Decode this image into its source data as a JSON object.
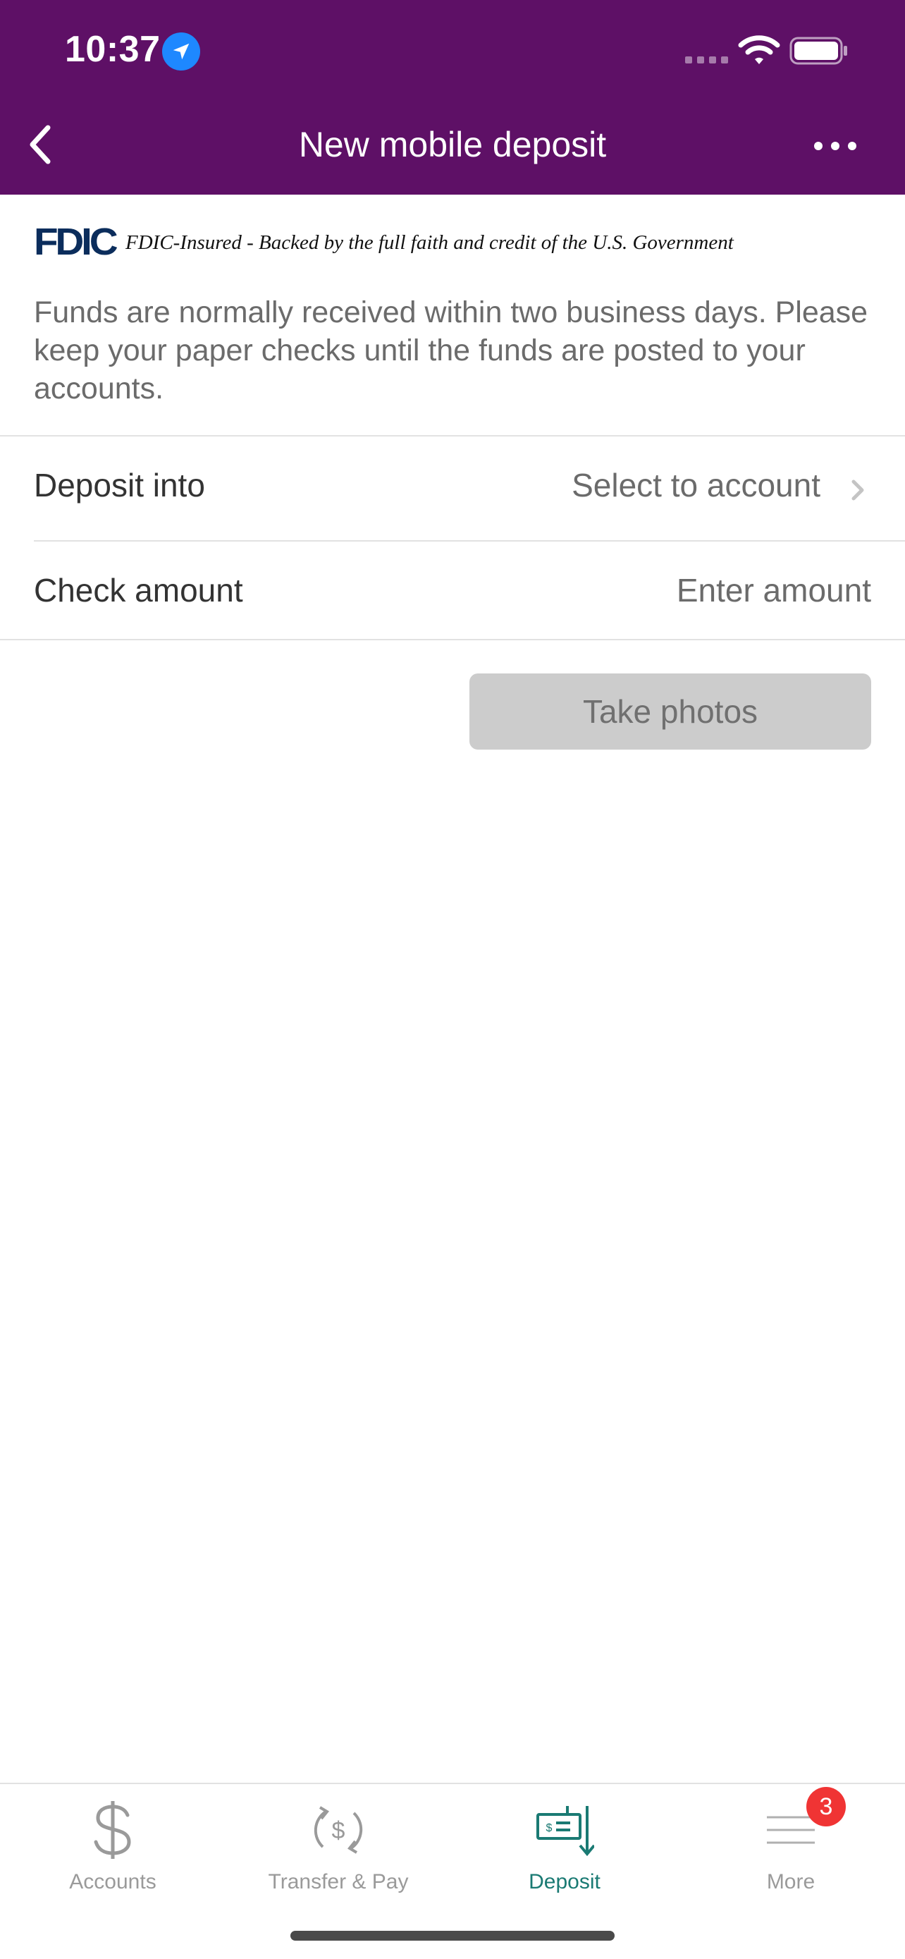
{
  "status_bar": {
    "time": "10:37"
  },
  "header": {
    "title": "New mobile deposit"
  },
  "fdic": {
    "logo": "FDIC",
    "text": "FDIC-Insured - Backed by the full faith and credit of the U.S. Government"
  },
  "notice": "Funds are normally received within two business days. Please keep your paper checks until the funds are posted to your accounts.",
  "form": {
    "deposit_into": {
      "label": "Deposit into",
      "value": "Select to account"
    },
    "check_amount": {
      "label": "Check amount",
      "placeholder": "Enter amount"
    }
  },
  "actions": {
    "take_photos": "Take photos"
  },
  "tabbar": {
    "tabs": [
      {
        "label": "Accounts",
        "icon": "dollar-icon"
      },
      {
        "label": "Transfer & Pay",
        "icon": "transfer-pay-icon"
      },
      {
        "label": "Deposit",
        "icon": "check-deposit-icon",
        "active": true
      },
      {
        "label": "More",
        "icon": "menu-icon"
      }
    ],
    "more_badge": "3"
  },
  "colors": {
    "header_bg": "#5e1066",
    "active_tab": "#1a7a73",
    "badge": "#f03434",
    "disabled_button": "#cccccc"
  }
}
